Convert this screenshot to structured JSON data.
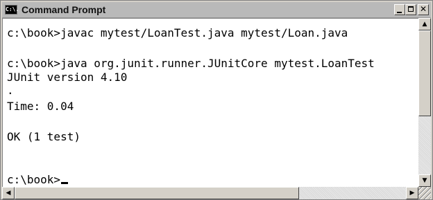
{
  "window": {
    "title": "Command Prompt",
    "icon_label": "C:\\.",
    "icon": "console-icon"
  },
  "buttons": {
    "minimize_icon": "minimize-icon",
    "maximize_icon": "maximize-icon",
    "close_icon": "close-icon",
    "close_glyph": "✕"
  },
  "console": {
    "lines": [
      "c:\\book>javac mytest/LoanTest.java mytest/Loan.java",
      "",
      "c:\\book>java org.junit.runner.JUnitCore mytest.LoanTest",
      "JUnit version 4.10",
      ".",
      "Time: 0.04",
      "",
      "OK (1 test)",
      "",
      "",
      "c:\\book>"
    ]
  },
  "scrollbars": {
    "up_arrow": "▲",
    "down_arrow": "▼",
    "left_arrow": "◀",
    "right_arrow": "▶"
  }
}
